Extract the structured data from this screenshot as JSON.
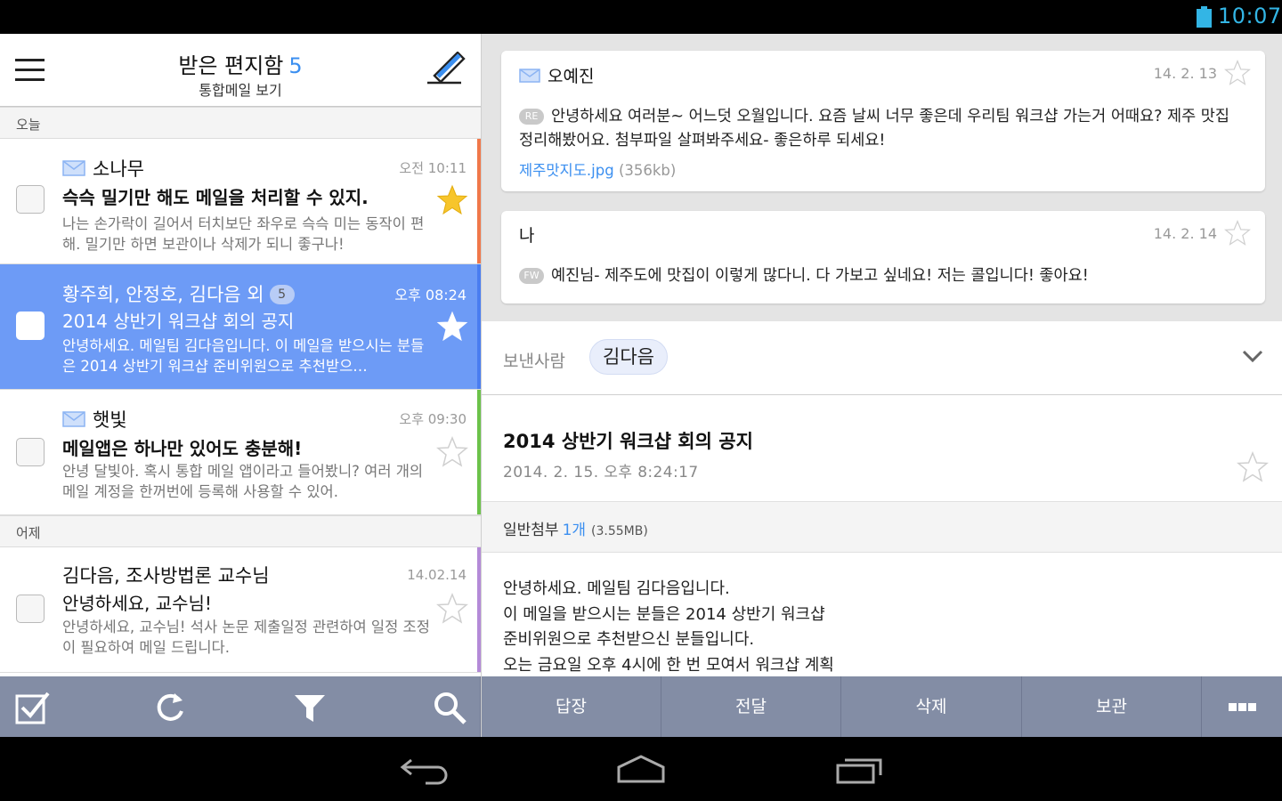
{
  "status": {
    "clock": "10:07",
    "accent": "#33b5e5"
  },
  "inbox": {
    "title": "받은 편지함",
    "count": "5",
    "subtitle": "통합메일 보기",
    "sections": {
      "today": "오늘",
      "yesterday": "어제"
    },
    "rows": [
      {
        "sender": "소나무",
        "time": "오전 10:11",
        "subject": "슥슥 밀기만 해도 메일을 처리할 수 있지.",
        "preview": "나는 손가락이 길어서 터치보단 좌우로 슥슥 미는 동작이 편해. 밀기만 하면 보관이나 삭제가 되니 좋구나!",
        "starred": true,
        "unread": true,
        "color": "#f0784a"
      },
      {
        "sender": "황주희, 안정호, 김다음 외",
        "badge": "5",
        "time": "오후 08:24",
        "subject": "2014 상반기 워크샵 회의 공지",
        "preview": "안녕하세요. 메일팀 김다음입니다. 이 메일을 받으시는 분들은 2014 상반기 워크샵 준비위원으로 추천받으…",
        "starred": false,
        "selected": true,
        "color": "#4a7df0"
      },
      {
        "sender": "햇빛",
        "time": "오후 09:30",
        "subject": "메일앱은 하나만 있어도 충분해!",
        "preview": "안녕 달빛아. 혹시 통합 메일 앱이라고 들어봤니? 여러 개의 메일 계정을 한꺼번에 등록해 사용할 수 있어.",
        "starred": false,
        "unread": true,
        "color": "#6cc24a"
      },
      {
        "sender": "김다음, 조사방법론 교수님",
        "time": "14.02.14",
        "subject": "안녕하세요, 교수님!",
        "preview": "안녕하세요, 교수님! 석사 논문 제출일정 관련하여 일정 조정이 필요하여 메일 드립니다.",
        "starred": false,
        "color": "#b48ad8"
      }
    ]
  },
  "thread": [
    {
      "name": "오예진",
      "date": "14. 2. 13",
      "tag": "RE",
      "body": "안녕하세요 여러분~ 어느덧 오월입니다. 요즘 날씨 너무 좋은데 우리팀 워크샵 가는거 어때요? 제주 맛집 정리해봤어요. 첨부파일 살펴봐주세요- 좋은하루 되세요!",
      "attach_name": "제주맛지도.jpg",
      "attach_size": "(356kb)"
    },
    {
      "name": "나",
      "date": "14. 2. 14",
      "tag": "FW",
      "body": "예진님- 제주도에 맛집이 이렇게 많다니. 다 가보고 싶네요! 저는 콜입니다! 좋아요!"
    }
  ],
  "message": {
    "sender_label": "보낸사람",
    "sender": "김다음",
    "subject": "2014 상반기 워크샵 회의 공지",
    "date": "2014. 2. 15. 오후 8:24:17",
    "attach_label": "일반첨부",
    "attach_count": "1개",
    "attach_size": "(3.55MB)",
    "body_lines": [
      "안녕하세요. 메일팀 김다음입니다.",
      "이 메일을 받으시는 분들은 2014 상반기 워크샵",
      "준비위원으로 추천받으신 분들입니다.",
      "오는 금요일 오후 4시에 한 번 모여서 워크샵 계획"
    ]
  },
  "actions": {
    "reply": "답장",
    "forward": "전달",
    "delete": "삭제",
    "archive": "보관"
  },
  "colors": {
    "selected_row": "#6d9bf6",
    "toolbar": "#838da5",
    "link": "#3b8ff0"
  }
}
